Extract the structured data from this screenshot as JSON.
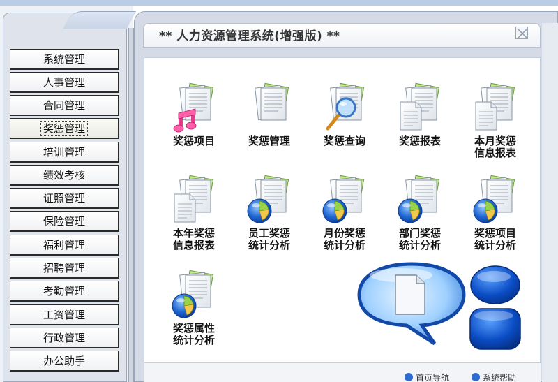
{
  "window": {
    "title": "** 人力资源管理系统(增强版) **"
  },
  "sidebar": {
    "items": [
      {
        "label": "系统管理",
        "active": false
      },
      {
        "label": "人事管理",
        "active": false
      },
      {
        "label": "合同管理",
        "active": false
      },
      {
        "label": "奖惩管理",
        "active": true
      },
      {
        "label": "培训管理",
        "active": false
      },
      {
        "label": "绩效考核",
        "active": false
      },
      {
        "label": "证照管理",
        "active": false
      },
      {
        "label": "保险管理",
        "active": false
      },
      {
        "label": "福利管理",
        "active": false
      },
      {
        "label": "招聘管理",
        "active": false
      },
      {
        "label": "考勤管理",
        "active": false
      },
      {
        "label": "工资管理",
        "active": false
      },
      {
        "label": "行政管理",
        "active": false
      },
      {
        "label": "办公助手",
        "active": false
      }
    ]
  },
  "tiles": [
    {
      "line1": "奖惩项目",
      "line2": "",
      "icon": "music-document-icon"
    },
    {
      "line1": "奖惩管理",
      "line2": "",
      "icon": "documents-icon"
    },
    {
      "line1": "奖惩查询",
      "line2": "",
      "icon": "search-document-icon"
    },
    {
      "line1": "奖惩报表",
      "line2": "",
      "icon": "report-document-icon"
    },
    {
      "line1": "本月奖惩",
      "line2": "信息报表",
      "icon": "report-document-icon"
    },
    {
      "line1": "本年奖惩",
      "line2": "信息报表",
      "icon": "report-document-icon"
    },
    {
      "line1": "员工奖惩",
      "line2": "统计分析",
      "icon": "pie-chart-document-icon"
    },
    {
      "line1": "月份奖惩",
      "line2": "统计分析",
      "icon": "pie-chart-document-icon"
    },
    {
      "line1": "部门奖惩",
      "line2": "统计分析",
      "icon": "pie-chart-document-icon"
    },
    {
      "line1": "奖惩项目",
      "line2": "统计分析",
      "icon": "pie-chart-document-icon"
    },
    {
      "line1": "奖惩属性",
      "line2": "统计分析",
      "icon": "pie-chart-document-icon"
    }
  ],
  "footer": {
    "link1": "首页导航",
    "link2": "系统帮助"
  },
  "colors": {
    "accent": "#1e56c8",
    "sidebar_bg": "#dfe4ec",
    "window_bg": "#d5dbe6"
  }
}
